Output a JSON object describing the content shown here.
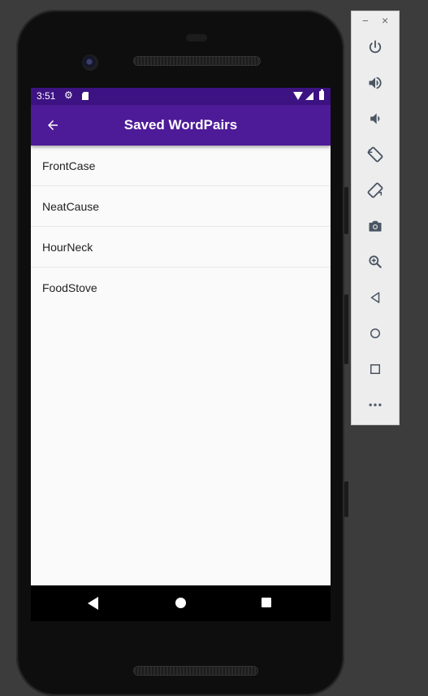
{
  "status_bar": {
    "time": "3:51"
  },
  "app_bar": {
    "title": "Saved WordPairs",
    "back_icon": "arrow-back-icon"
  },
  "saved_list": {
    "items": [
      {
        "label": "FrontCase"
      },
      {
        "label": "NeatCause"
      },
      {
        "label": "HourNeck"
      },
      {
        "label": "FoodStove"
      }
    ]
  },
  "nav_bar": {
    "icons": [
      "nav-back-icon",
      "nav-home-icon",
      "nav-recents-icon"
    ]
  },
  "emulator_panel": {
    "window_controls": {
      "minimize": "−",
      "close": "×"
    },
    "tools": [
      "power-icon",
      "volume-up-icon",
      "volume-down-icon",
      "rotate-left-icon",
      "rotate-right-icon",
      "camera-icon",
      "zoom-icon",
      "back-icon",
      "home-icon",
      "overview-icon",
      "more-icon"
    ]
  },
  "colors": {
    "status_bar": "#3d1282",
    "app_bar": "#4d1a98",
    "list_background": "#fafafa",
    "panel_background": "#ededed",
    "panel_icon": "#4a5563",
    "desktop_background": "#3c3c3c"
  }
}
